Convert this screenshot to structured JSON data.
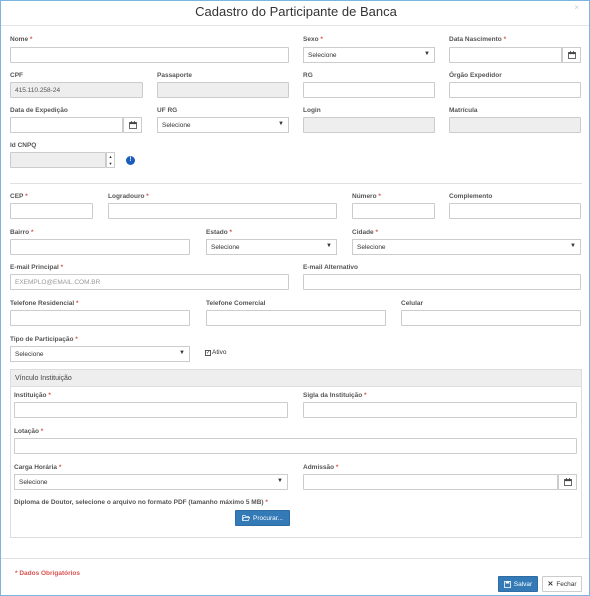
{
  "modal": {
    "title": "Cadastro do Participante de Banca",
    "close": "×"
  },
  "req_mark": "*",
  "fields": {
    "nome": {
      "label": "Nome",
      "value": ""
    },
    "sexo": {
      "label": "Sexo",
      "value": "Selecione"
    },
    "nascimento": {
      "label": "Data Nascimento",
      "value": ""
    },
    "cpf": {
      "label": "CPF",
      "value": "415.110.258-24"
    },
    "passaporte": {
      "label": "Passaporte",
      "value": ""
    },
    "rg": {
      "label": "RG",
      "value": ""
    },
    "orgao": {
      "label": "Órgão Expedidor",
      "value": ""
    },
    "expedicao": {
      "label": "Data de Expedição",
      "value": ""
    },
    "uf_rg": {
      "label": "UF RG",
      "value": "Selecione"
    },
    "login": {
      "label": "Login",
      "value": ""
    },
    "matricula": {
      "label": "Matrícula",
      "value": ""
    },
    "cnpq": {
      "label": "Id CNPQ",
      "value": ""
    },
    "cep": {
      "label": "CEP",
      "value": ""
    },
    "logradouro": {
      "label": "Logradouro",
      "value": ""
    },
    "numero": {
      "label": "Número",
      "value": ""
    },
    "complemento": {
      "label": "Complemento",
      "value": ""
    },
    "bairro": {
      "label": "Bairro",
      "value": ""
    },
    "estado": {
      "label": "Estado",
      "value": "Selecione"
    },
    "cidade": {
      "label": "Cidade",
      "value": "Selecione"
    },
    "email": {
      "label": "E-mail Principal",
      "placeholder": "EXEMPLO@EMAIL.COM.BR"
    },
    "email_alt": {
      "label": "E-mail Alternativo",
      "value": ""
    },
    "tel_res": {
      "label": "Telefone Residencial",
      "value": ""
    },
    "tel_com": {
      "label": "Telefone Comercial",
      "value": ""
    },
    "celular": {
      "label": "Celular",
      "value": ""
    },
    "tipo": {
      "label": "Tipo de Participação",
      "value": "Selecione"
    },
    "ativo": {
      "label": "Ativo",
      "checked": true
    }
  },
  "vinculo": {
    "heading": "Vínculo Instituição",
    "instituicao": {
      "label": "Instituição",
      "value": ""
    },
    "sigla": {
      "label": "Sigla da Instituição",
      "value": ""
    },
    "lotacao": {
      "label": "Lotação",
      "value": ""
    },
    "carga": {
      "label": "Carga Horária",
      "value": "Selecione"
    },
    "admissao": {
      "label": "Admissão",
      "value": ""
    },
    "diploma": {
      "label": "Diploma de Doutor, selecione o arquivo no formato PDF (tamanho máximo 5 MB)",
      "button": "Procurar..."
    }
  },
  "footer": {
    "required_note": "* Dados Obrigatórios",
    "save": "Salvar",
    "close": "Fechar"
  },
  "colors": {
    "required": "#d9534f",
    "primary": "#337ab7",
    "info": "#1a5dbd"
  }
}
